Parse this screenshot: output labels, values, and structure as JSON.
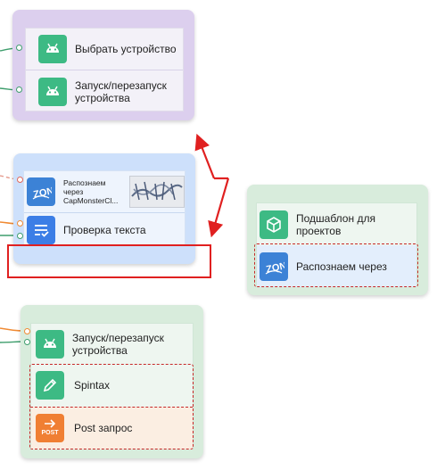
{
  "group_top": {
    "items": [
      {
        "label": "Выбрать устройство",
        "icon": "android-icon"
      },
      {
        "label": "Запуск/перезапуск устройства",
        "icon": "android-icon"
      }
    ]
  },
  "group_middle": {
    "items": [
      {
        "label": "Распознаем через CapMonsterCl...",
        "icon": "captcha-icon"
      },
      {
        "label": "Проверка текста",
        "icon": "text-check-icon"
      }
    ]
  },
  "group_right": {
    "items": [
      {
        "label": "Подшаблон для проектов",
        "icon": "cube-icon"
      },
      {
        "label": "Распознаем через",
        "icon": "captcha-icon"
      }
    ]
  },
  "group_bottom": {
    "items": [
      {
        "label": "Запуск/перезапуск устройства",
        "icon": "android-icon"
      },
      {
        "label": "Spintax",
        "icon": "pencil-icon"
      },
      {
        "label": "Post запрос",
        "icon": "post-icon",
        "badge": "POST"
      }
    ]
  },
  "colors": {
    "android": "#3dba84",
    "captcha": "#3c82d6",
    "text_check": "#3c7ee6",
    "post": "#f07f33",
    "highlight": "#e02020"
  }
}
